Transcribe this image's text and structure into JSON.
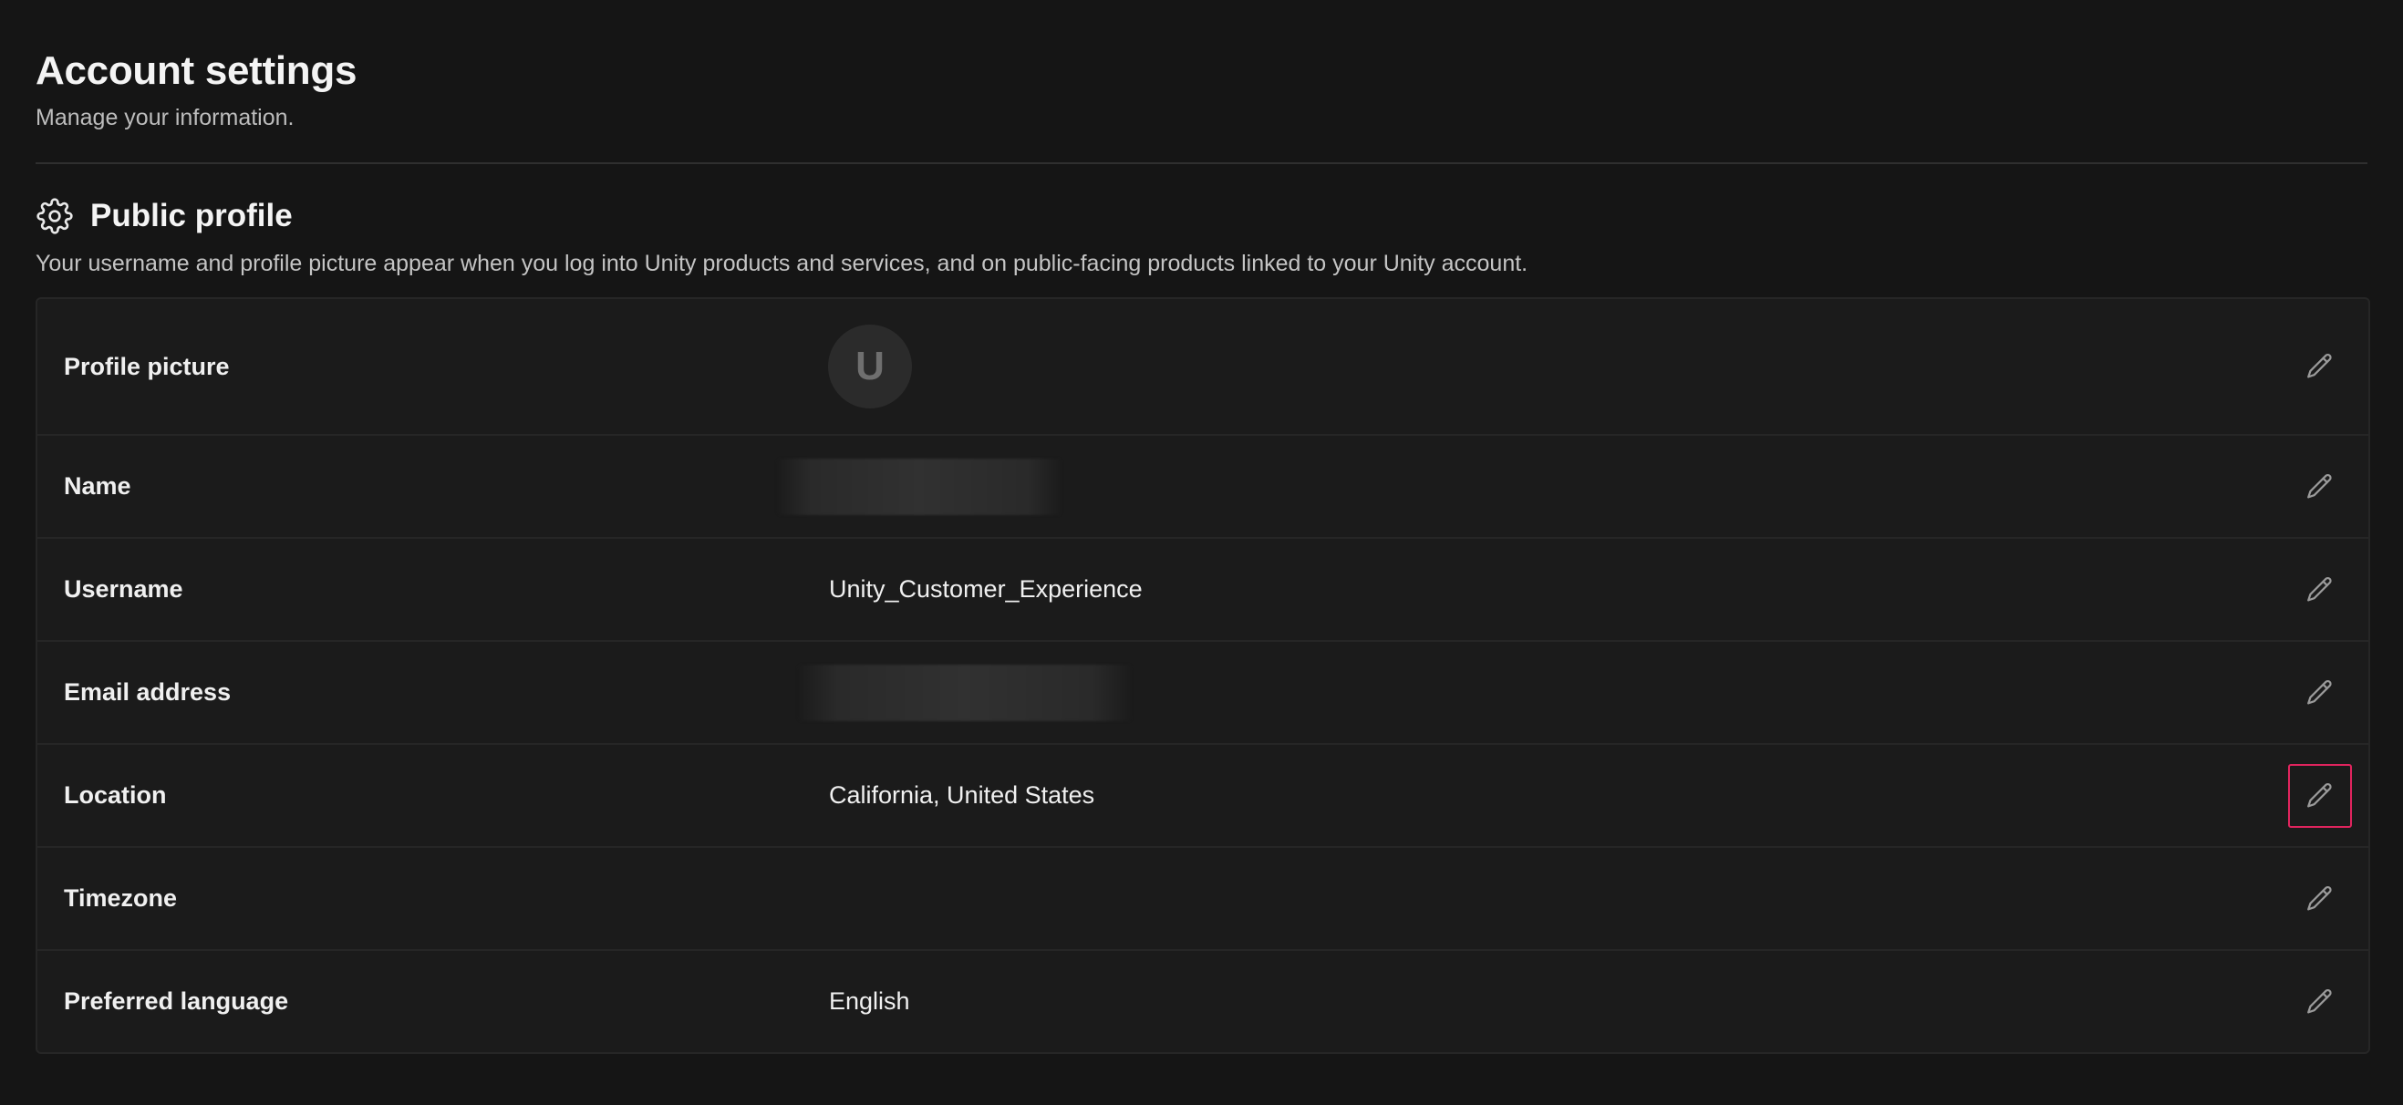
{
  "header": {
    "title": "Account settings",
    "subtitle": "Manage your information."
  },
  "section": {
    "icon": "gear-icon",
    "title": "Public profile",
    "description": "Your username and profile picture appear when you log into Unity products and services, and on public-facing products linked to your Unity account."
  },
  "rows": [
    {
      "label": "Profile picture",
      "avatar_initial": "U",
      "value_type": "avatar"
    },
    {
      "label": "Name",
      "value": "",
      "value_type": "redacted"
    },
    {
      "label": "Username",
      "value": "Unity_Customer_Experience",
      "value_type": "text"
    },
    {
      "label": "Email address",
      "value": "",
      "value_type": "redacted"
    },
    {
      "label": "Location",
      "value": "California, United States",
      "value_type": "text",
      "edit_highlighted": true
    },
    {
      "label": "Timezone",
      "value": "",
      "value_type": "text"
    },
    {
      "label": "Preferred language",
      "value": "English",
      "value_type": "text"
    }
  ],
  "edit_icon": "pencil-icon",
  "colors": {
    "background": "#151515",
    "card": "#1b1b1b",
    "highlight": "#e0245e"
  }
}
